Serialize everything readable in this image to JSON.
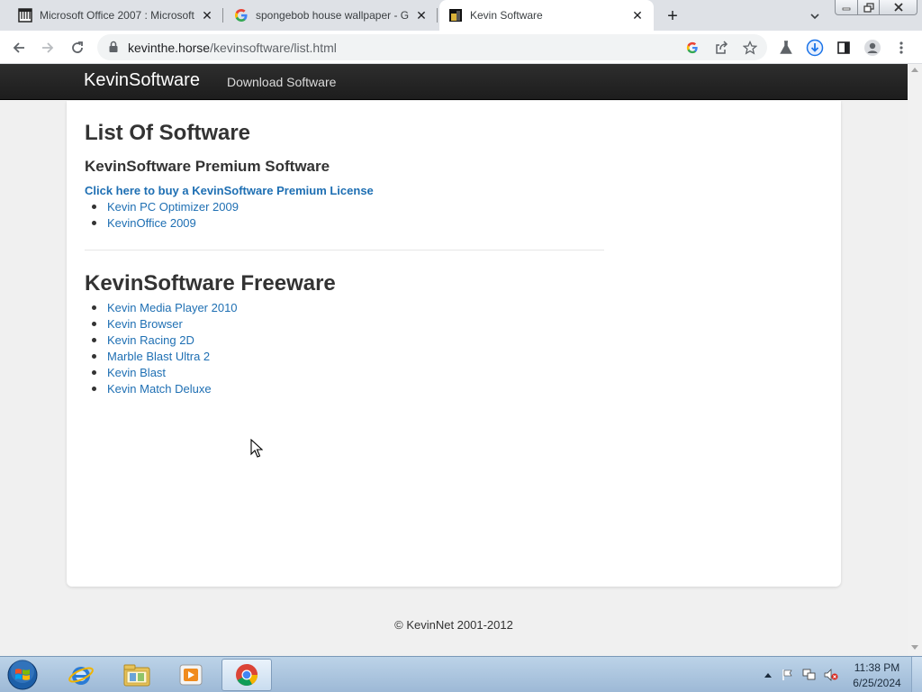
{
  "browser": {
    "tabs": [
      {
        "title": "Microsoft Office 2007 : Microsoft",
        "favicon": "archive-icon",
        "active": false
      },
      {
        "title": "spongebob house wallpaper - Go",
        "favicon": "google-g-icon",
        "active": false
      },
      {
        "title": "Kevin Software",
        "favicon": "kevin-favicon",
        "active": true
      }
    ],
    "new_tab_label": "+",
    "close_label": "✕",
    "url": {
      "host": "kevinthe.horse",
      "path": "/kevinsoftware/list.html"
    }
  },
  "page": {
    "brand": "KevinSoftware",
    "nav_links": [
      "Download Software"
    ],
    "title": "List Of Software",
    "premium": {
      "heading": "KevinSoftware Premium Software",
      "buy_link": "Click here to buy a KevinSoftware Premium License",
      "items": [
        "Kevin PC Optimizer 2009",
        "KevinOffice 2009"
      ]
    },
    "freeware": {
      "heading": "KevinSoftware Freeware",
      "items": [
        "Kevin Media Player 2010",
        "Kevin Browser",
        "Kevin Racing 2D",
        "Marble Blast Ultra 2",
        "Kevin Blast",
        "Kevin Match Deluxe"
      ]
    },
    "footer": "© KevinNet 2001-2012"
  },
  "taskbar": {
    "pinned": [
      "internet-explorer-icon",
      "windows-explorer-icon",
      "media-player-icon",
      "chrome-icon"
    ],
    "active_app": "chrome-icon",
    "clock": {
      "time": "11:38 PM",
      "date": "6/25/2024"
    }
  },
  "colors": {
    "link": "#1e6fb3",
    "navbar": "#222222",
    "text": "#333333",
    "taskbar": "#a9c3de"
  }
}
